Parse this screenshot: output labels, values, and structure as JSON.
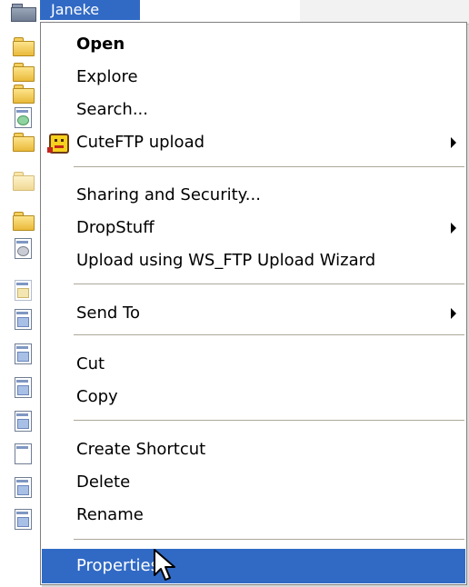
{
  "selected_item": {
    "label": "Janeke"
  },
  "context_menu": {
    "items": [
      {
        "label": "Open",
        "bold": true
      },
      {
        "label": "Explore"
      },
      {
        "label": "Search..."
      },
      {
        "label": "CuteFTP upload",
        "icon": "cuteftp-icon",
        "submenu": true
      },
      {
        "label": "Sharing and Security..."
      },
      {
        "label": "DropStuff",
        "submenu": true
      },
      {
        "label": "Upload using WS_FTP Upload Wizard"
      },
      {
        "label": "Send To",
        "submenu": true
      },
      {
        "label": "Cut"
      },
      {
        "label": "Copy"
      },
      {
        "label": "Create Shortcut"
      },
      {
        "label": "Delete"
      },
      {
        "label": "Rename"
      },
      {
        "label": "Properties",
        "highlighted": true
      }
    ]
  },
  "colors": {
    "selection_blue": "#316ac5",
    "menu_background": "#ffffff",
    "separator": "#aca899"
  }
}
